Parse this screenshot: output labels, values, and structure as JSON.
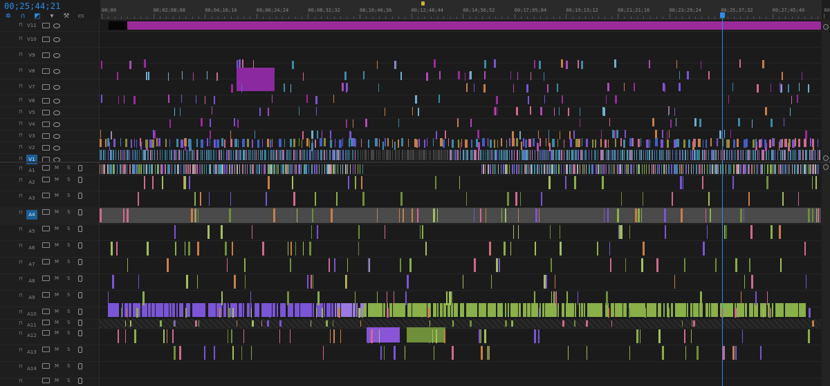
{
  "header": {
    "timecode": "00;25;44;21",
    "tools": [
      "snap-icon",
      "linked-selection-icon",
      "add-marker-icon",
      "track-settings-icon",
      "wrench-icon",
      "captions-icon"
    ]
  },
  "ruler": {
    "labels": [
      "00;00",
      "00;02;08;08",
      "00;04;16;16",
      "00;06;24;24",
      "00;08;32;32",
      "00;10;40;36",
      "00;12;48;44",
      "00;14;56;52",
      "00;17;05;04",
      "00;19;13;12",
      "00;21;21;16",
      "00;23;29;24",
      "00;25;37;32",
      "00;27;45;40",
      "00;2"
    ]
  },
  "video_tracks": [
    {
      "name": "V11",
      "selected": false
    },
    {
      "name": "V10",
      "selected": false
    },
    {
      "name": "V9",
      "selected": false
    },
    {
      "name": "V8",
      "selected": false
    },
    {
      "name": "V7",
      "selected": false
    },
    {
      "name": "V6",
      "selected": false
    },
    {
      "name": "V5",
      "selected": false
    },
    {
      "name": "V4",
      "selected": false
    },
    {
      "name": "V3",
      "selected": false
    },
    {
      "name": "V2",
      "selected": false
    },
    {
      "name": "V1",
      "selected": true
    }
  ],
  "audio_tracks": [
    {
      "name": "A1",
      "m": "M",
      "s": "S",
      "selected": false
    },
    {
      "name": "A2",
      "m": "M",
      "s": "S",
      "selected": false
    },
    {
      "name": "A3",
      "m": "M",
      "s": "S",
      "selected": false
    },
    {
      "name": "A4",
      "m": "M",
      "s": "S",
      "selected": true
    },
    {
      "name": "A5",
      "m": "M",
      "s": "S",
      "selected": false
    },
    {
      "name": "A6",
      "m": "M",
      "s": "S",
      "selected": false
    },
    {
      "name": "A7",
      "m": "M",
      "s": "S",
      "selected": false
    },
    {
      "name": "A8",
      "m": "M",
      "s": "S",
      "selected": false
    },
    {
      "name": "A9",
      "m": "M",
      "s": "S",
      "selected": false
    },
    {
      "name": "A10",
      "m": "M",
      "s": "S",
      "selected": false
    },
    {
      "name": "A11",
      "m": "M",
      "s": "S",
      "selected": false
    },
    {
      "name": "A12",
      "m": "M",
      "s": "S",
      "selected": false
    },
    {
      "name": "A13",
      "m": "M",
      "s": "S",
      "selected": false
    },
    {
      "name": "A14",
      "m": "M",
      "s": "S",
      "selected": false
    },
    {
      "name": "",
      "m": "M",
      "s": "S",
      "selected": false
    }
  ],
  "colors": {
    "accent": "#2d8ceb",
    "magenta": "#9b2a9b",
    "teal": "#3e8aa8",
    "violet": "#7a55d6",
    "green": "#8ab04a",
    "grey_track": "#4a4a4a",
    "pink": "#c07090",
    "orange": "#c88048"
  }
}
